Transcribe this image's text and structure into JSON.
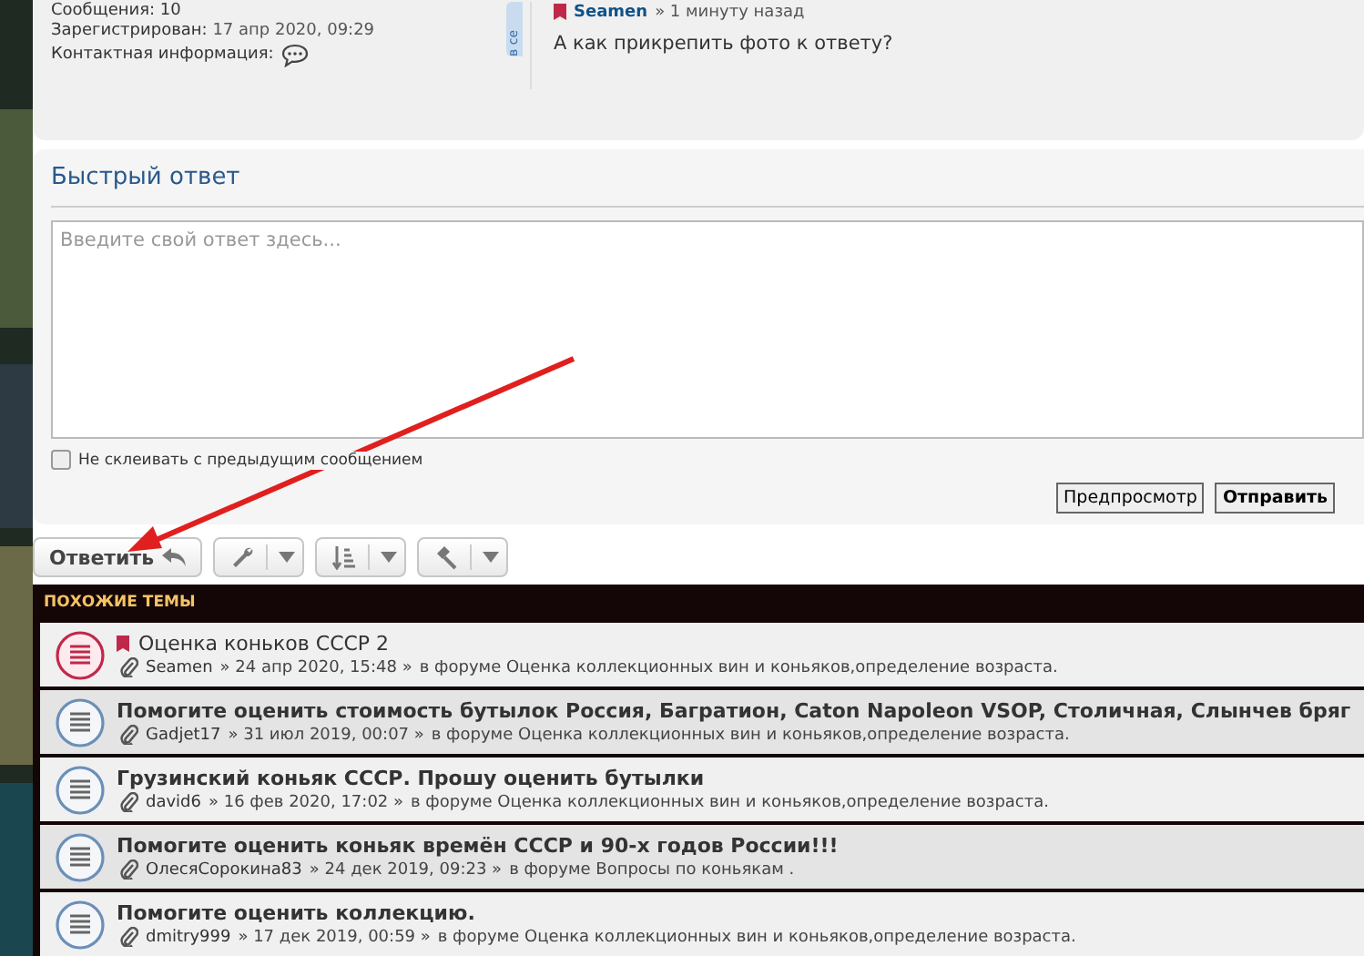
{
  "profile": {
    "posts_label": "Сообщения:",
    "posts": "10",
    "registered_label": "Зарегистрирован:",
    "registered": "17 апр 2020, 09:29",
    "contact_label": "Контактная информация:"
  },
  "side_tab": "в се",
  "post": {
    "author": "Seamen",
    "time": "» 1 минуту назад",
    "text": "А как прикрепить фото к ответу?"
  },
  "quick_reply": {
    "title": "Быстрый ответ",
    "placeholder": "Введите свой ответ здесь...",
    "no_merge": {
      "label": "Не склеивать с предыдущим сообщением",
      "checked": false
    },
    "buttons": [
      {
        "label": "Предпросмотр",
        "primary": false
      },
      {
        "label": "Отправить",
        "primary": true
      }
    ]
  },
  "toolbar": {
    "reply": "Ответить",
    "tools": [
      {
        "kind": "wrench"
      },
      {
        "kind": "sort"
      },
      {
        "kind": "hammer"
      }
    ]
  },
  "similar": {
    "title": "ПОХОЖИЕ ТЕМЫ",
    "topics": [
      {
        "title": "Оценка коньков СССР 2",
        "unread": true,
        "author": "Seamen",
        "date": "» 24 апр 2020, 15:48 »",
        "forum": "в форуме Оценка коллекционных вин и коньяков,определение возраста."
      },
      {
        "title": "Помогите оценить стоимость бутылок Россия, Багратион, Caton Napoleon VSOP, Столичная, Слынчев бряг",
        "unread": false,
        "author": "Gadjet17",
        "date": "» 31 июл 2019, 00:07 »",
        "forum": "в форуме Оценка коллекционных вин и коньяков,определение возраста."
      },
      {
        "title": "Грузинский коньяк СССР. Прошу оценить бутылки",
        "unread": false,
        "author": "david6",
        "date": "» 16 фев 2020, 17:02 »",
        "forum": "в форуме Оценка коллекционных вин и коньяков,определение возраста."
      },
      {
        "title": "Помогите оценить коньяк времён СССР и 90-х годов России!!!",
        "unread": false,
        "author": "ОлесяСорокина83",
        "date": "» 24 дек 2019, 09:23 »",
        "forum": "в форуме Вопросы по коньякам ."
      },
      {
        "title": "Помогите оценить коллекцию.",
        "unread": false,
        "author": "dmitry999",
        "date": "» 17 дек 2019, 00:59 »",
        "forum": "в форуме Оценка коллекционных вин и коньяков,определение возраста."
      }
    ]
  }
}
